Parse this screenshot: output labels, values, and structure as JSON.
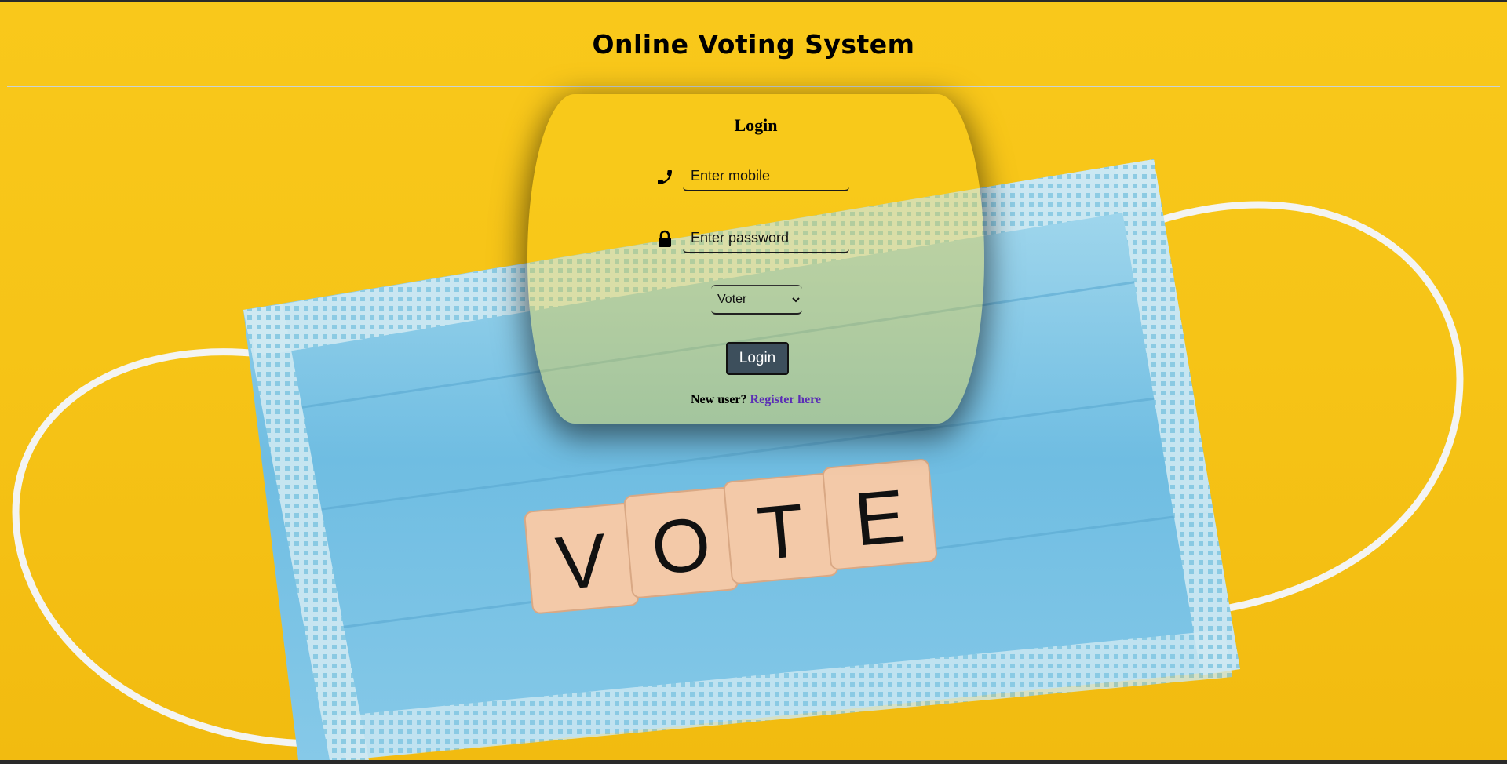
{
  "header": {
    "title": "Online Voting System"
  },
  "login": {
    "heading": "Login",
    "mobile_placeholder": "Enter mobile",
    "password_placeholder": "Enter password",
    "role_selected": "Voter",
    "submit_label": "Login",
    "register_prompt": "New user?",
    "register_link": "Register here"
  },
  "background": {
    "tiles": [
      "V",
      "O",
      "T",
      "E"
    ]
  },
  "icons": {
    "phone": "phone-icon",
    "lock": "lock-icon"
  },
  "colors": {
    "background_yellow": "#f7c518",
    "button": "#3d4f5c",
    "link": "#5b2fb5",
    "mask_blue": "#7fc4e4"
  }
}
